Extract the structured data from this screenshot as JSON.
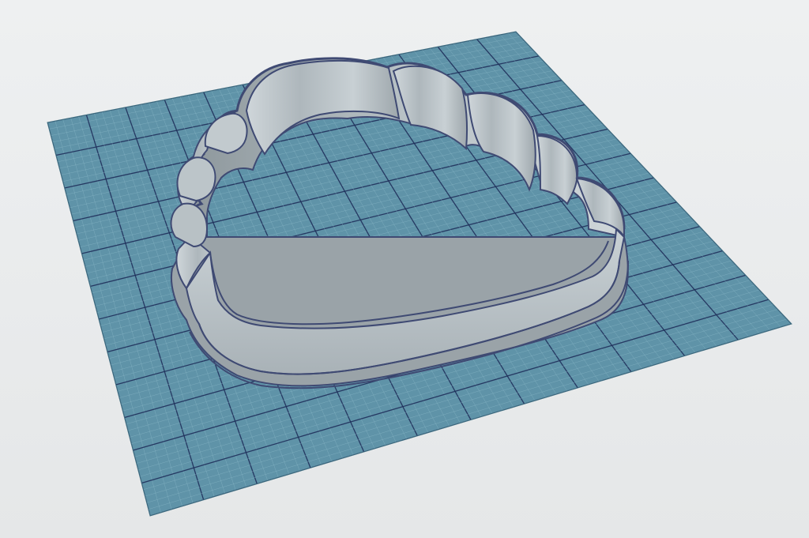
{
  "viewport": {
    "background": "#e9ebec",
    "grid_plane_color": "#5f93a8",
    "grid_minor_line_color": "#8fbccb",
    "grid_major_line_color": "#1f2f5a",
    "object_wall_color": "#b7c0c5",
    "object_top_color": "#8f979c",
    "object_edge_color": "#3f4a73"
  },
  "object": {
    "icon": "cloud-shaped-cookie-cutter",
    "grid": "perspective-grid-plane"
  }
}
